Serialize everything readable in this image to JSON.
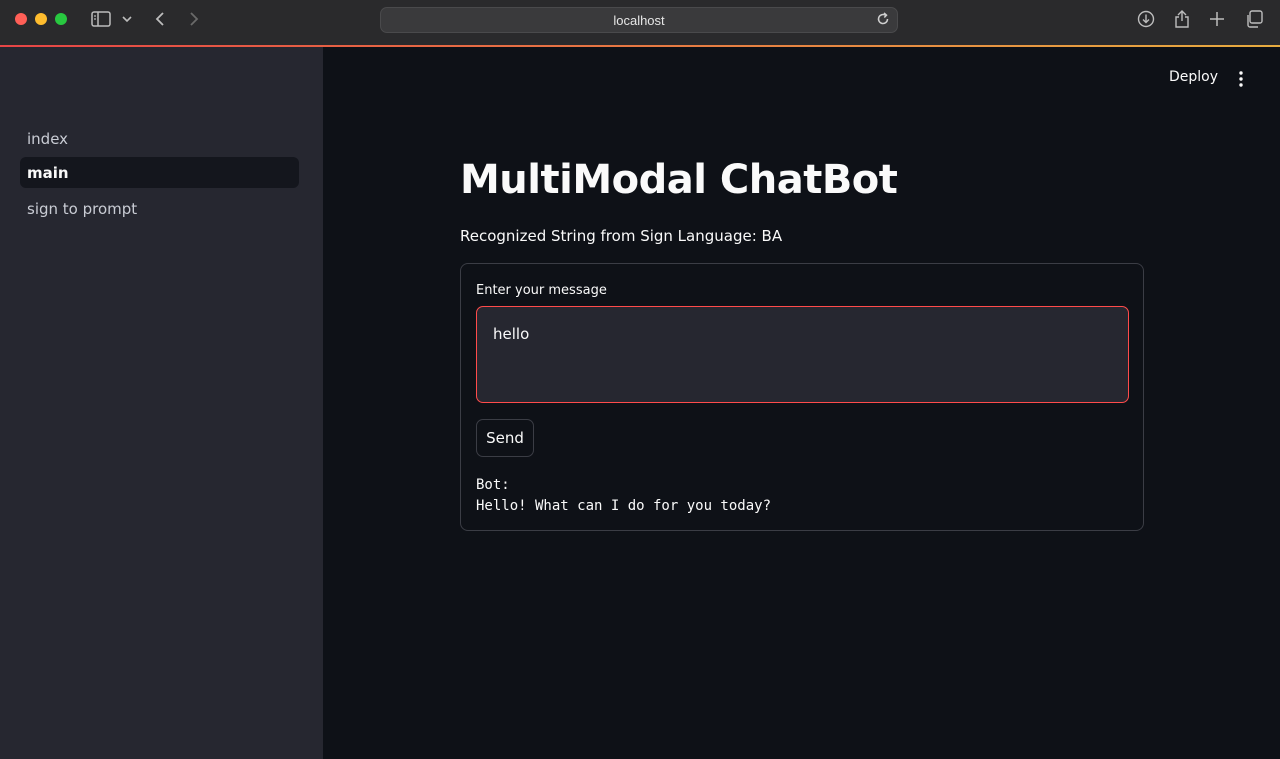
{
  "browser": {
    "url": "localhost",
    "colors": {
      "close": "#ff5f57",
      "minimize": "#febc2e",
      "maximize": "#28c840"
    }
  },
  "sidebar": {
    "items": [
      {
        "label": "index",
        "active": false
      },
      {
        "label": "main",
        "active": true
      },
      {
        "label": "sign to prompt",
        "active": false
      }
    ]
  },
  "header": {
    "deploy_label": "Deploy",
    "menu_icon": "kebab-menu-icon"
  },
  "main": {
    "title": "MultiModal ChatBot",
    "recognized_text": "Recognized String from Sign Language: BA",
    "form": {
      "label": "Enter your message",
      "message_value": "hello",
      "send_label": "Send",
      "bot_label": "Bot:",
      "bot_reply": "Hello! What can I do for you today?"
    }
  },
  "colors": {
    "accent": "#ff4b4b",
    "sidebar_bg": "#262730",
    "main_bg": "#0e1117"
  }
}
